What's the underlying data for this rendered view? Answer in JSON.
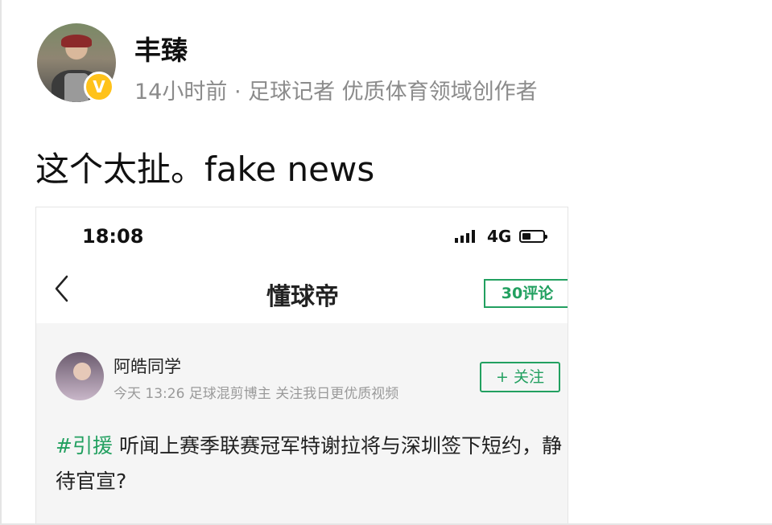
{
  "post": {
    "author": "丰臻",
    "verified_badge": "V",
    "meta": "14小时前 · 足球记者 优质体育领域创作者",
    "text": "这个太扯。fake news"
  },
  "embedded_screenshot": {
    "status_bar": {
      "time": "18:08",
      "network": "4G"
    },
    "nav": {
      "title": "懂球帝",
      "comments_button": "30评论"
    },
    "article": {
      "user_name": "阿皓同学",
      "user_meta": "今天 13:26  足球混剪博主 关注我日更优质视频",
      "follow_button": "+ 关注",
      "tag": "#引援",
      "text": "听闻上赛季联赛冠军特谢拉将与深圳签下短约，静待官宣?"
    }
  },
  "colors": {
    "accent_green": "#22a060",
    "badge_yellow": "#ffc21a",
    "meta_gray": "#8b8b8b"
  }
}
